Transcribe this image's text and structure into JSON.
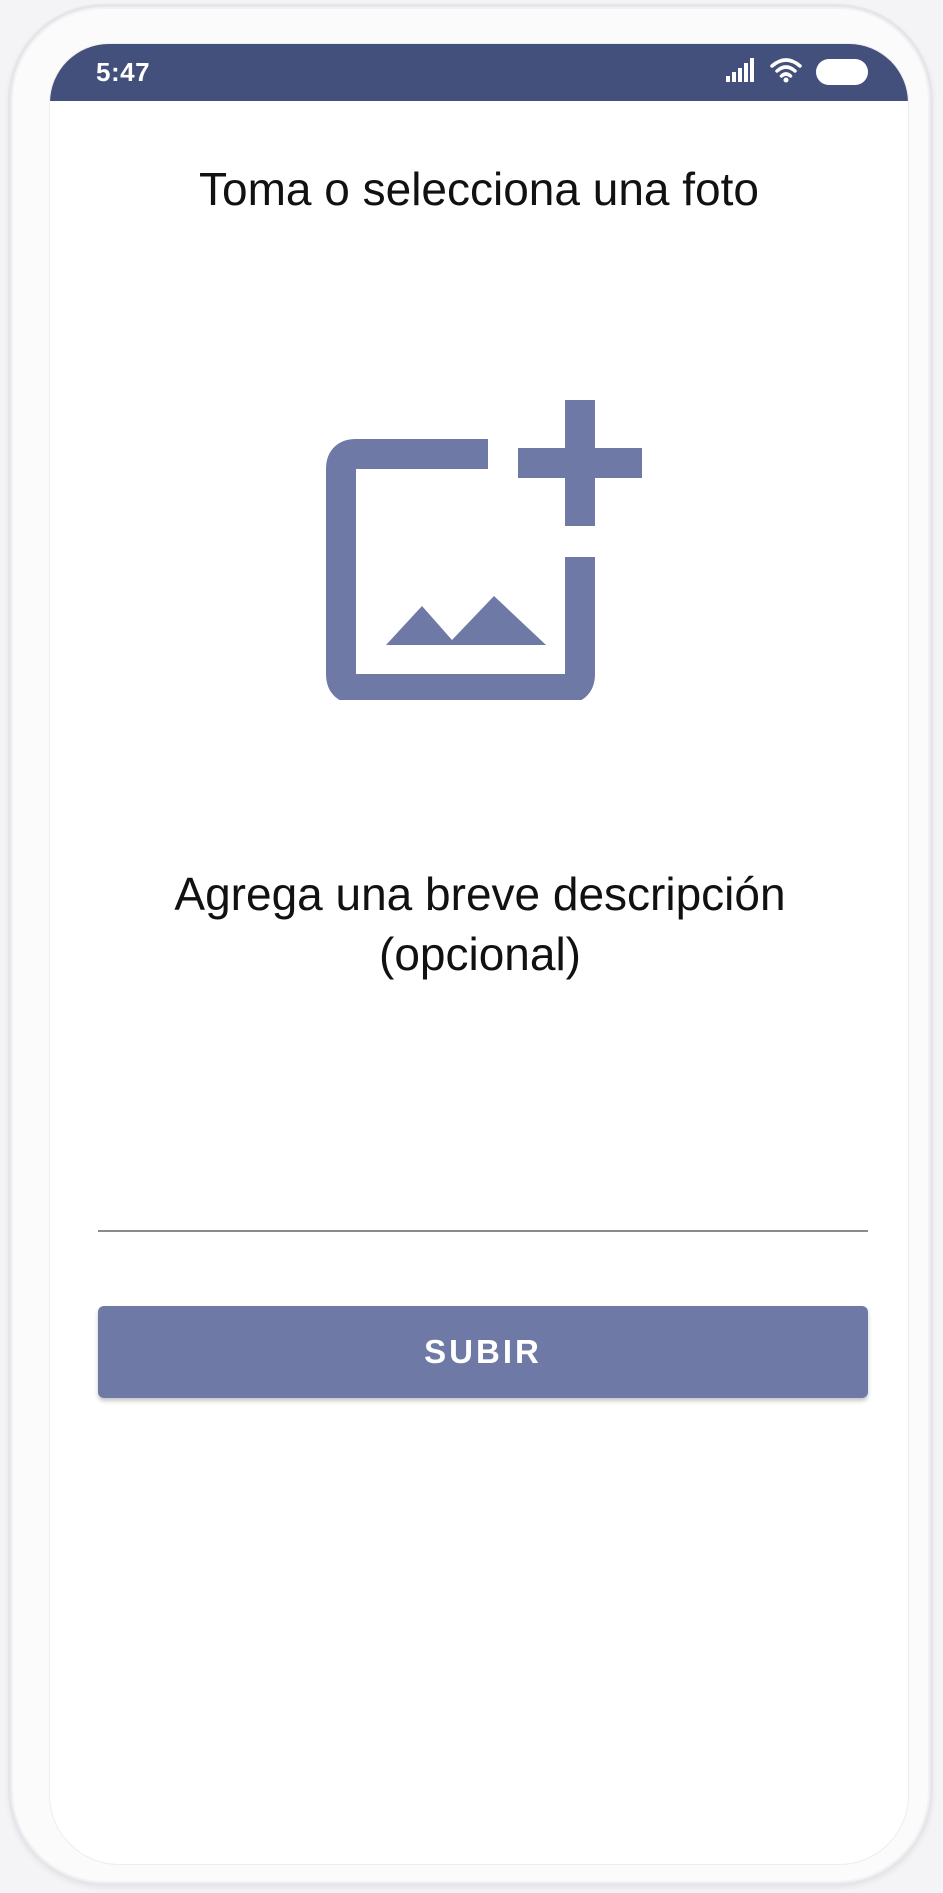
{
  "status_bar": {
    "time": "5:47",
    "icons": [
      "signal-icon",
      "wifi-icon",
      "battery-icon"
    ],
    "background_color": "#44507c"
  },
  "main": {
    "title": "Toma o selecciona una foto",
    "photo_icon": "add-photo-icon",
    "description_label": "Agrega una breve descripción (opcional)",
    "description_value": "",
    "upload_label": "SUBIR"
  },
  "colors": {
    "accent": "#6e79a6",
    "status_bar": "#44507c"
  }
}
